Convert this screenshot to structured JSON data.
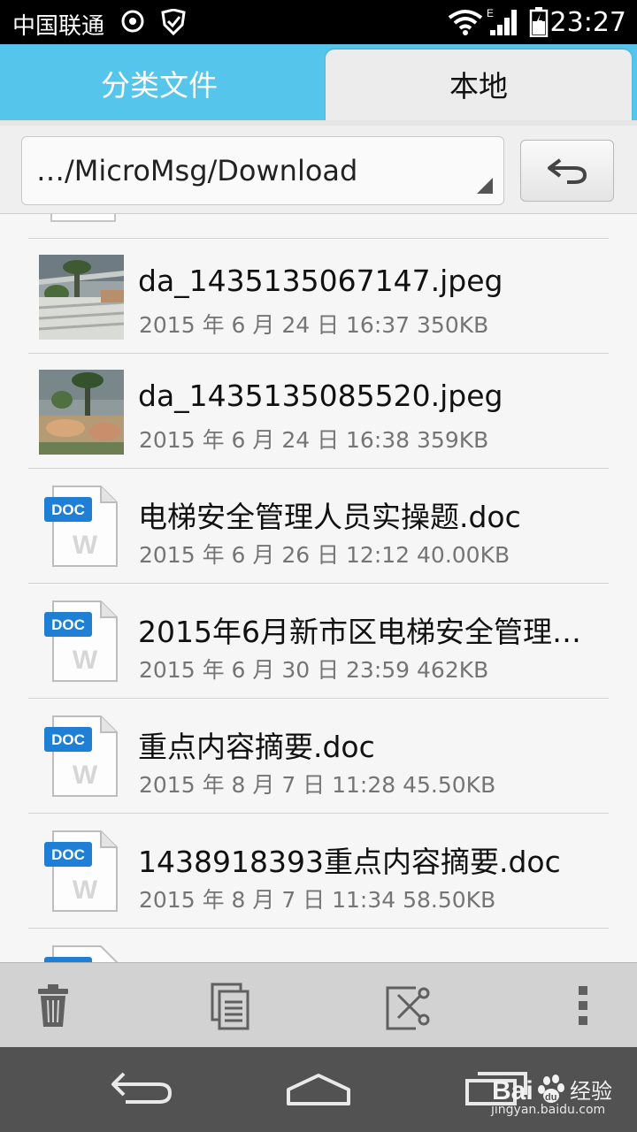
{
  "status_bar": {
    "carrier": "中国联通",
    "time": "23:27",
    "network_label": "E"
  },
  "tabs": [
    {
      "label": "分类文件",
      "active": false
    },
    {
      "label": "本地",
      "active": true
    }
  ],
  "path_bar": {
    "path": "…/MicroMsg/Download"
  },
  "files": [
    {
      "name": "da_1435135067147.jpeg",
      "meta": "2015 年 6 月 24 日 16:37 350KB",
      "type": "image"
    },
    {
      "name": "da_1435135085520.jpeg",
      "meta": "2015 年 6 月 24 日 16:38 359KB",
      "type": "image"
    },
    {
      "name": "电梯安全管理人员实操题.doc",
      "meta": "2015 年 6 月 26 日 12:12 40.00KB",
      "type": "doc"
    },
    {
      "name": "2015年6月新市区电梯安全管理…",
      "meta": "2015 年 6 月 30 日 23:59 462KB",
      "type": "doc"
    },
    {
      "name": "重点内容摘要.doc",
      "meta": "2015 年 8 月 7 日 11:28 45.50KB",
      "type": "doc"
    },
    {
      "name": "1438918393重点内容摘要.doc",
      "meta": "2015 年 8 月 7 日 11:34 58.50KB",
      "type": "doc"
    }
  ],
  "doc_badge": "DOC",
  "doc_letter": "W",
  "action_bar": {
    "icons": [
      "trash-icon",
      "copy-icon",
      "cut-icon",
      "more-icon"
    ]
  },
  "nav_bar": {
    "icons": [
      "back-icon",
      "home-icon",
      "recents-icon"
    ]
  },
  "watermark": {
    "brand": "Bai",
    "brand_suffix": "du",
    "label": "经验",
    "url": "jingyan.baidu.com"
  },
  "colors": {
    "tab_bar": "#55c5ec",
    "doc_badge": "#1e7fd4",
    "nav_bar": "#525252",
    "action_bar": "#d2d2d2"
  }
}
